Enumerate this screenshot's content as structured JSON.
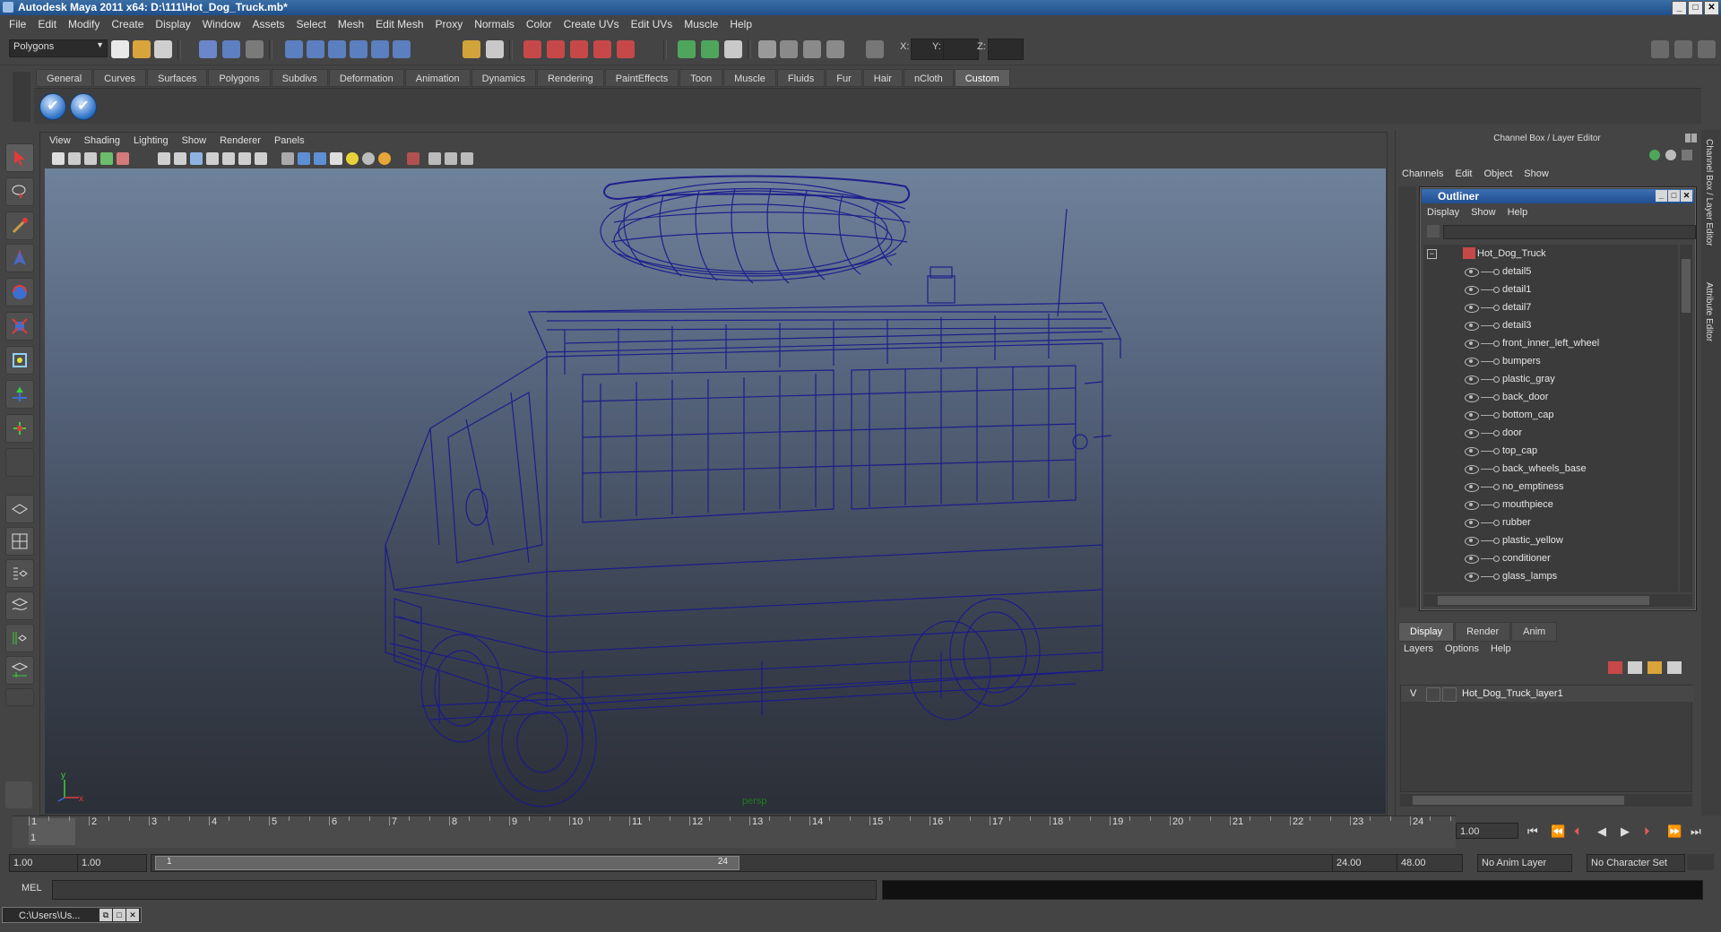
{
  "window": {
    "title": "Autodesk Maya 2011 x64: D:\\111\\Hot_Dog_Truck.mb*",
    "controls": [
      "_",
      "□",
      "✕"
    ]
  },
  "menubar": [
    "File",
    "Edit",
    "Modify",
    "Create",
    "Display",
    "Window",
    "Assets",
    "Select",
    "Mesh",
    "Edit Mesh",
    "Proxy",
    "Normals",
    "Color",
    "Create UVs",
    "Edit UVs",
    "Muscle",
    "Help"
  ],
  "statusline": {
    "mode": "Polygons",
    "x_label": "X:",
    "y_label": "Y:",
    "z_label": "Z:"
  },
  "shelf": {
    "tabs": [
      "General",
      "Curves",
      "Surfaces",
      "Polygons",
      "Subdivs",
      "Deformation",
      "Animation",
      "Dynamics",
      "Rendering",
      "PaintEffects",
      "Toon",
      "Muscle",
      "Fluids",
      "Fur",
      "Hair",
      "nCloth",
      "Custom"
    ],
    "active_tab": "Custom"
  },
  "viewport": {
    "menu": [
      "View",
      "Shading",
      "Lighting",
      "Show",
      "Renderer",
      "Panels"
    ],
    "camera_label": "persp",
    "axis_x": "x",
    "axis_y": "y",
    "wire_color": "#1a1a8c"
  },
  "channelbox": {
    "title": "Channel Box / Layer Editor",
    "menu": [
      "Channels",
      "Edit",
      "Object",
      "Show"
    ],
    "side_tabs": [
      "Channel Box / Layer Editor",
      "Attribute Editor"
    ]
  },
  "outliner": {
    "title": "Outliner",
    "menu": [
      "Display",
      "Show",
      "Help"
    ],
    "root": "Hot_Dog_Truck",
    "items": [
      "detail5",
      "detail1",
      "detail7",
      "detail3",
      "front_inner_left_wheel",
      "bumpers",
      "plastic_gray",
      "back_door",
      "bottom_cap",
      "door",
      "top_cap",
      "back_wheels_base",
      "no_emptiness",
      "mouthpiece",
      "rubber",
      "plastic_yellow",
      "conditioner",
      "glass_lamps"
    ]
  },
  "layers": {
    "tabs": [
      "Display",
      "Render",
      "Anim"
    ],
    "active_tab": "Display",
    "menu": [
      "Layers",
      "Options",
      "Help"
    ],
    "layer_visibility": "V",
    "layer_name": "Hot_Dog_Truck_layer1"
  },
  "timeline": {
    "frames": [
      "1",
      "2",
      "3",
      "4",
      "5",
      "6",
      "7",
      "8",
      "9",
      "10",
      "11",
      "12",
      "13",
      "14",
      "15",
      "16",
      "17",
      "18",
      "19",
      "20",
      "21",
      "22",
      "23",
      "24"
    ],
    "current_frame": "1",
    "current_time": "1.00"
  },
  "range": {
    "start": "1.00",
    "start2": "1.00",
    "handle_start": "1",
    "handle_end": "24",
    "end": "24.00",
    "end2": "48.00",
    "anim_layer": "No Anim Layer",
    "char_set": "No Character Set"
  },
  "cmdline": {
    "label": "MEL"
  },
  "taskbar": {
    "item": "C:\\Users\\Us..."
  }
}
